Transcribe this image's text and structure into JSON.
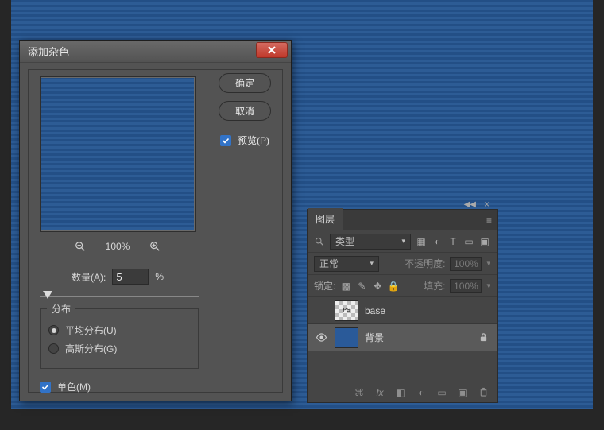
{
  "dialog": {
    "title": "添加杂色",
    "ok_label": "确定",
    "cancel_label": "取消",
    "preview_label": "预览(P)",
    "preview_checked": true,
    "zoom": {
      "level": "100%"
    },
    "amount": {
      "label": "数量(A):",
      "value": "5",
      "unit": "%"
    },
    "distribution": {
      "legend": "分布",
      "uniform_label": "平均分布(U)",
      "gaussian_label": "高斯分布(G)",
      "selected": "uniform"
    },
    "monochrome": {
      "label": "单色(M)",
      "checked": true
    }
  },
  "layers_panel": {
    "tab": "图层",
    "filter_label": "类型",
    "blend_mode": "正常",
    "opacity_label": "不透明度:",
    "opacity_value": "100%",
    "lock_label": "锁定:",
    "fill_label": "填充:",
    "fill_value": "100%",
    "layers": [
      {
        "name": "base",
        "visible": false,
        "locked": false,
        "thumb": "checker"
      },
      {
        "name": "背景",
        "visible": true,
        "locked": true,
        "thumb": "blue"
      }
    ]
  },
  "icons": {
    "zoom_out": "−",
    "zoom_in": "+",
    "eye": "●",
    "lock": "🔒"
  }
}
